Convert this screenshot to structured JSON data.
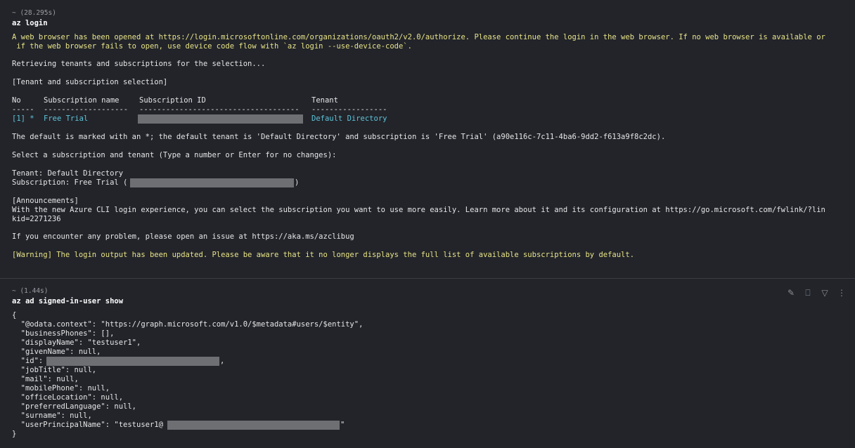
{
  "block1": {
    "duration": "~ (28.295s)",
    "command": "az login",
    "browser_line1": "A web browser has been opened at https://login.microsoftonline.com/organizations/oauth2/v2.0/authorize. Please continue the login in the web browser. If no web browser is available or",
    "browser_line2": " if the web browser fails to open, use device code flow with `az login --use-device-code`.",
    "retrieving": "Retrieving tenants and subscriptions for the selection...",
    "section_title": "[Tenant and subscription selection]",
    "table": {
      "col_no": "No",
      "col_name": "Subscription name",
      "col_id": "Subscription ID",
      "col_tenant": "Tenant",
      "sep_no": "-----",
      "sep_name": "-------------------",
      "sep_id": "------------------------------------",
      "sep_tenant": "-----------------",
      "row": {
        "no": "[1] *",
        "name": "Free Trial",
        "tenant": "Default Directory"
      }
    },
    "default_line": "The default is marked with an *; the default tenant is 'Default Directory' and subscription is 'Free Trial' (a90e116c-7c11-4ba6-9dd2-f613a9f8c2dc).",
    "select_prompt": "Select a subscription and tenant (Type a number or Enter for no changes):",
    "tenant_line": "Tenant: Default Directory",
    "subscription_prefix": "Subscription: Free Trial (",
    "subscription_suffix": ")",
    "announcements_title": "[Announcements]",
    "announce_line1": "With the new Azure CLI login experience, you can select the subscription you want to use more easily. Learn more about it and its configuration at https://go.microsoft.com/fwlink/?lin",
    "announce_line2": "kid=2271236",
    "problem_line": "If you encounter any problem, please open an issue at https://aka.ms/azclibug",
    "warning_line": "[Warning] The login output has been updated. Please be aware that it no longer displays the full list of available subscriptions by default."
  },
  "block2": {
    "duration": "~ (1.44s)",
    "command": "az ad signed-in-user show",
    "json_lines": [
      "{",
      "  \"@odata.context\": \"https://graph.microsoft.com/v1.0/$metadata#users/$entity\",",
      "  \"businessPhones\": [],",
      "  \"displayName\": \"testuser1\",",
      "  \"givenName\": null,",
      "  \"id\": ",
      "  \"jobTitle\": null,",
      "  \"mail\": null,",
      "  \"mobilePhone\": null,",
      "  \"officeLocation\": null,",
      "  \"preferredLanguage\": null,",
      "  \"surname\": null,",
      "  \"userPrincipalName\": \"testuser1@",
      "}"
    ],
    "id_suffix": ",",
    "upn_suffix": "\"",
    "toolbar": {
      "icons": [
        "pin-icon",
        "bookmark-icon",
        "filter-icon",
        "more-icon"
      ],
      "glyphs": [
        "✎",
        "⎕",
        "▽",
        "⋮"
      ]
    }
  }
}
